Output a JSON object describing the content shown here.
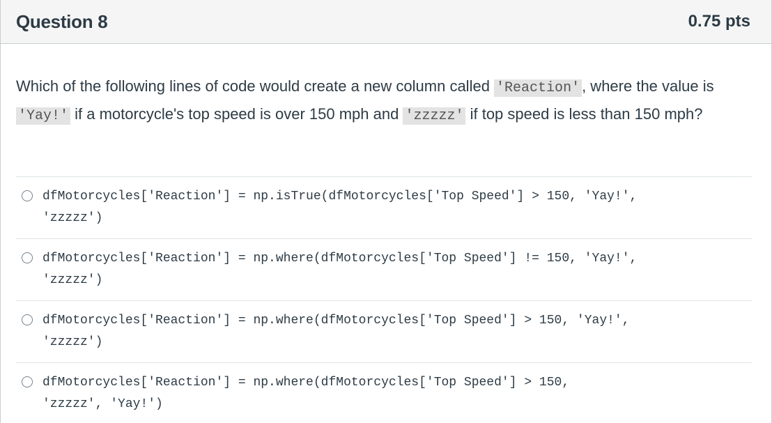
{
  "header": {
    "title": "Question 8",
    "points": "0.75 pts"
  },
  "question": {
    "part1": "Which of the following lines of code would create a new column called ",
    "code1": "'Reaction'",
    "part2": ", where the value is ",
    "code2": "'Yay!'",
    "part3": " if a motorcycle's top speed is over 150 mph and ",
    "code3": "'zzzzz'",
    "part4": " if top speed is less than 150 mph?"
  },
  "answers": [
    {
      "line1": "dfMotorcycles['Reaction'] = np.isTrue(dfMotorcycles['Top Speed'] > 150, 'Yay!',",
      "line2": "'zzzzz')"
    },
    {
      "line1": "dfMotorcycles['Reaction'] = np.where(dfMotorcycles['Top Speed'] != 150, 'Yay!',",
      "line2": "'zzzzz')"
    },
    {
      "line1": "dfMotorcycles['Reaction'] = np.where(dfMotorcycles['Top Speed'] > 150, 'Yay!',",
      "line2": "'zzzzz')"
    },
    {
      "line1": "dfMotorcycles['Reaction'] = np.where(dfMotorcycles['Top Speed'] > 150,",
      "line2": "'zzzzz', 'Yay!')"
    }
  ]
}
